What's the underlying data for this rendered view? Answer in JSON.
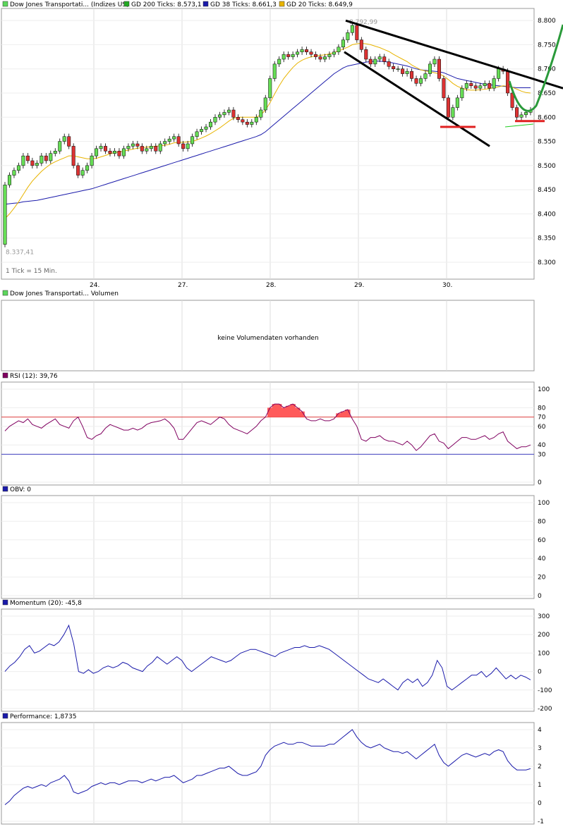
{
  "chart_data": [
    {
      "type": "candlestick",
      "title": "Dow Jones Transportati... (Indizes US)",
      "legend": [
        {
          "label": "Dow Jones Transportati... (Indizes US)",
          "color": "#5cd65c"
        },
        {
          "label": "GD 200 Ticks: 8.573,1",
          "color": "#22aa22"
        },
        {
          "label": "GD 38 Ticks: 8.661,3",
          "color": "#1a1aaa"
        },
        {
          "label": "GD 20 Ticks: 8.649,9",
          "color": "#e8b400"
        }
      ],
      "ylim": [
        8265,
        8825
      ],
      "yticks": [
        8300,
        8350,
        8400,
        8450,
        8500,
        8550,
        8600,
        8650,
        8700,
        8750,
        8800
      ],
      "ytick_labels": [
        "8.300",
        "8.350",
        "8.400",
        "8.450",
        "8.500",
        "8.550",
        "8.600",
        "8.650",
        "8.700",
        "8.750",
        "8.800"
      ],
      "xtick_labels": [
        "24.",
        "27.",
        "28.",
        "29.",
        "30."
      ],
      "max_label": "8.792,99",
      "min_label": "8.337,41",
      "interval_note": "1 Tick = 15 Min.",
      "close": [
        8460,
        8480,
        8490,
        8500,
        8520,
        8510,
        8500,
        8505,
        8520,
        8510,
        8525,
        8530,
        8550,
        8560,
        8540,
        8500,
        8480,
        8490,
        8500,
        8520,
        8535,
        8540,
        8530,
        8525,
        8530,
        8520,
        8535,
        8540,
        8545,
        8540,
        8530,
        8535,
        8540,
        8530,
        8545,
        8550,
        8555,
        8560,
        8545,
        8535,
        8545,
        8560,
        8570,
        8575,
        8580,
        8590,
        8600,
        8605,
        8610,
        8615,
        8600,
        8595,
        8590,
        8585,
        8590,
        8600,
        8615,
        8640,
        8680,
        8710,
        8720,
        8730,
        8725,
        8730,
        8735,
        8740,
        8735,
        8730,
        8725,
        8720,
        8725,
        8730,
        8735,
        8745,
        8760,
        8775,
        8790,
        8760,
        8740,
        8720,
        8710,
        8720,
        8725,
        8715,
        8705,
        8700,
        8700,
        8690,
        8695,
        8680,
        8670,
        8680,
        8690,
        8710,
        8720,
        8680,
        8640,
        8600,
        8620,
        8640,
        8660,
        8670,
        8665,
        8660,
        8665,
        8670,
        8660,
        8680,
        8700,
        8695,
        8650,
        8620,
        8600,
        8605,
        8610,
        8615
      ],
      "ma200": [
        8420,
        8421,
        8422,
        8423,
        8425,
        8426,
        8427,
        8428,
        8430,
        8432,
        8434,
        8436,
        8438,
        8440,
        8442,
        8444,
        8446,
        8448,
        8450,
        8452,
        8455,
        8458,
        8461,
        8464,
        8467,
        8470,
        8473,
        8476,
        8479,
        8482,
        8485,
        8488,
        8491,
        8494,
        8497,
        8500,
        8503,
        8506,
        8509,
        8512,
        8515,
        8518,
        8521,
        8524,
        8527,
        8530,
        8533,
        8536,
        8539,
        8542,
        8545,
        8548,
        8551,
        8554,
        8557,
        8560,
        8564,
        8570,
        8578,
        8586,
        8594,
        8602,
        8610,
        8618,
        8626,
        8634,
        8642,
        8650,
        8658,
        8666,
        8674,
        8682,
        8690,
        8696,
        8702,
        8706,
        8708,
        8710,
        8712,
        8714,
        8715,
        8716,
        8716,
        8715,
        8714,
        8712,
        8710,
        8708,
        8706,
        8703,
        8700,
        8698,
        8697,
        8696,
        8695,
        8694,
        8692,
        8688,
        8684,
        8680,
        8678,
        8676,
        8674,
        8672,
        8670,
        8668,
        8667,
        8666,
        8665,
        8664,
        8663,
        8662,
        8661,
        8661,
        8661,
        8661
      ],
      "ma20": [
        8390,
        8400,
        8412,
        8425,
        8440,
        8455,
        8468,
        8478,
        8488,
        8496,
        8503,
        8508,
        8512,
        8516,
        8520,
        8520,
        8518,
        8516,
        8514,
        8514,
        8515,
        8518,
        8521,
        8524,
        8527,
        8528,
        8530,
        8532,
        8534,
        8536,
        8537,
        8538,
        8539,
        8540,
        8541,
        8542,
        8544,
        8547,
        8548,
        8548,
        8549,
        8550,
        8553,
        8557,
        8561,
        8566,
        8572,
        8578,
        8585,
        8592,
        8598,
        8600,
        8600,
        8600,
        8600,
        8600,
        8605,
        8615,
        8630,
        8648,
        8665,
        8680,
        8692,
        8703,
        8712,
        8718,
        8722,
        8725,
        8727,
        8728,
        8729,
        8731,
        8734,
        8737,
        8741,
        8745,
        8750,
        8752,
        8753,
        8752,
        8750,
        8747,
        8744,
        8740,
        8736,
        8730,
        8725,
        8720,
        8715,
        8708,
        8703,
        8698,
        8696,
        8694,
        8692,
        8690,
        8685,
        8678,
        8670,
        8664,
        8660,
        8657,
        8656,
        8656,
        8657,
        8658,
        8659,
        8661,
        8663,
        8665,
        8664,
        8662,
        8658,
        8654,
        8651,
        8650
      ]
    },
    {
      "type": "volume",
      "title": "Dow Jones Transportati... Volumen",
      "message": "keine Volumendaten vorhanden"
    },
    {
      "type": "line",
      "title": "RSI (12): 39,76",
      "ylim": [
        0,
        100
      ],
      "yticks": [
        0,
        30,
        40,
        60,
        70,
        80,
        100
      ],
      "ytick_labels": [
        "0",
        "30",
        "40",
        "60",
        "70",
        "80",
        "100"
      ],
      "ref_lines": [
        {
          "value": 70,
          "label": "70",
          "color": "#e04040"
        },
        {
          "value": 30,
          "label": "30",
          "color": "#4040c0"
        }
      ],
      "values": [
        55,
        60,
        63,
        66,
        64,
        68,
        62,
        60,
        58,
        62,
        65,
        68,
        62,
        60,
        58,
        66,
        70,
        60,
        48,
        46,
        50,
        52,
        58,
        62,
        60,
        58,
        56,
        56,
        58,
        56,
        58,
        62,
        64,
        65,
        66,
        68,
        64,
        58,
        46,
        46,
        52,
        58,
        64,
        66,
        64,
        62,
        66,
        70,
        68,
        62,
        58,
        56,
        54,
        52,
        56,
        60,
        66,
        70,
        80,
        84,
        84,
        80,
        82,
        84,
        80,
        76,
        68,
        66,
        66,
        68,
        66,
        66,
        68,
        74,
        76,
        78,
        68,
        60,
        46,
        44,
        48,
        48,
        50,
        46,
        44,
        44,
        42,
        40,
        44,
        40,
        34,
        38,
        44,
        50,
        52,
        44,
        42,
        36,
        40,
        44,
        48,
        48,
        46,
        46,
        48,
        50,
        46,
        48,
        52,
        54,
        44,
        40,
        36,
        38,
        38,
        40
      ]
    },
    {
      "type": "line",
      "title": "OBV: 0",
      "ylim": [
        0,
        100
      ],
      "yticks": [
        0,
        20,
        40,
        60,
        80,
        100
      ],
      "ytick_labels": [
        "0",
        "20",
        "40",
        "60",
        "80",
        "100"
      ],
      "values": []
    },
    {
      "type": "line",
      "title": "Momentum (20): -45,8",
      "ylim": [
        -200,
        300
      ],
      "yticks": [
        -200,
        -100,
        0,
        100,
        200,
        300
      ],
      "ytick_labels": [
        "-200",
        "-100",
        "0",
        "100",
        "200",
        "300"
      ],
      "values": [
        0,
        30,
        50,
        80,
        120,
        140,
        100,
        110,
        130,
        150,
        140,
        160,
        200,
        250,
        150,
        0,
        -10,
        10,
        -10,
        0,
        20,
        30,
        20,
        30,
        50,
        40,
        20,
        10,
        0,
        30,
        50,
        80,
        60,
        40,
        60,
        80,
        60,
        20,
        0,
        20,
        40,
        60,
        80,
        70,
        60,
        50,
        60,
        80,
        100,
        110,
        120,
        120,
        110,
        100,
        90,
        80,
        100,
        110,
        120,
        130,
        130,
        140,
        130,
        130,
        140,
        130,
        120,
        100,
        80,
        60,
        40,
        20,
        0,
        -20,
        -40,
        -50,
        -60,
        -40,
        -60,
        -80,
        -100,
        -60,
        -40,
        -60,
        -40,
        -80,
        -60,
        -20,
        60,
        20,
        -80,
        -100,
        -80,
        -60,
        -40,
        -20,
        -20,
        0,
        -30,
        -10,
        20,
        -10,
        -40,
        -20,
        -40,
        -20,
        -30,
        -45
      ]
    },
    {
      "type": "line",
      "title": "Performance: 1,8735",
      "ylim": [
        -1,
        4
      ],
      "yticks": [
        -1,
        0,
        1,
        2,
        3,
        4
      ],
      "ytick_labels": [
        "-1",
        "0",
        "1",
        "2",
        "3",
        "4"
      ],
      "values": [
        -0.1,
        0.1,
        0.4,
        0.6,
        0.8,
        0.9,
        0.8,
        0.9,
        1.0,
        0.9,
        1.1,
        1.2,
        1.3,
        1.5,
        1.2,
        0.6,
        0.5,
        0.6,
        0.7,
        0.9,
        1.0,
        1.1,
        1.0,
        1.1,
        1.1,
        1.0,
        1.1,
        1.2,
        1.2,
        1.2,
        1.1,
        1.2,
        1.3,
        1.2,
        1.3,
        1.4,
        1.4,
        1.5,
        1.3,
        1.1,
        1.2,
        1.3,
        1.5,
        1.5,
        1.6,
        1.7,
        1.8,
        1.9,
        1.9,
        2.0,
        1.8,
        1.6,
        1.5,
        1.5,
        1.6,
        1.7,
        2.0,
        2.6,
        2.9,
        3.1,
        3.2,
        3.3,
        3.2,
        3.2,
        3.3,
        3.3,
        3.2,
        3.1,
        3.1,
        3.1,
        3.1,
        3.2,
        3.2,
        3.4,
        3.6,
        3.8,
        4.0,
        3.6,
        3.3,
        3.1,
        3.0,
        3.1,
        3.2,
        3.0,
        2.9,
        2.8,
        2.8,
        2.7,
        2.8,
        2.6,
        2.4,
        2.6,
        2.8,
        3.0,
        3.2,
        2.6,
        2.2,
        2.0,
        2.2,
        2.4,
        2.6,
        2.7,
        2.6,
        2.5,
        2.6,
        2.7,
        2.6,
        2.8,
        2.9,
        2.8,
        2.3,
        2.0,
        1.8,
        1.8,
        1.8,
        1.87
      ]
    }
  ]
}
